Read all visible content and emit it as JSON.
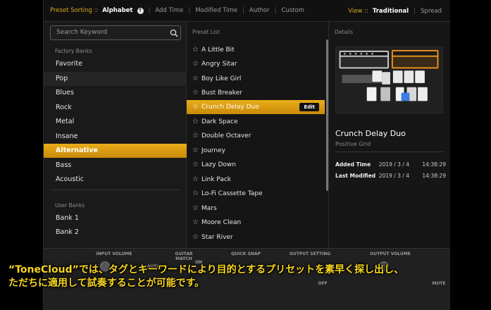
{
  "topbar": {
    "sort_label": "Preset Sorting ::",
    "sort_options": [
      "Alphabet",
      "Add Time",
      "Modified Time",
      "Author",
      "Custom"
    ],
    "view_label": "View ::",
    "view_options": [
      "Traditional",
      "Spread"
    ]
  },
  "search": {
    "placeholder": "Search Keyword"
  },
  "banks": {
    "factory_header": "Factory Banks",
    "factory": [
      "Favorite",
      "Pop",
      "Blues",
      "Rock",
      "Metal",
      "Insane",
      "Alternative",
      "Bass",
      "Acoustic"
    ],
    "user_header": "User Banks",
    "user": [
      "Bank 1",
      "Bank 2"
    ]
  },
  "presets": {
    "header": "Preset List",
    "items": [
      "A Little Bit",
      "Angry Sitar",
      "Boy Like Girl",
      "Bust Breaker",
      "Crunch Delay Duo",
      "Dark Space",
      "Double Octaver",
      "Journey",
      "Lazy Down",
      "Link Pack",
      "Lo-Fi Cassette Tape",
      "Mars",
      "Moore Clean",
      "Star River"
    ],
    "edit_label": "Edit"
  },
  "details": {
    "header": "Details",
    "name": "Crunch Delay Duo",
    "author": "Positive Grid",
    "added_label": "Added Time",
    "added_date": "2019 / 3 / 4",
    "added_time": "14:38:29",
    "modified_label": "Last Modified",
    "modified_date": "2019 / 3 / 4",
    "modified_time": "14:38:29"
  },
  "bottom": {
    "input_volume": "INPUT VOLUME",
    "guitar_match": "GUITAR MATCH",
    "quick_snap": "QUICK SNAP",
    "output_setting": "OUTPUT SETTING",
    "output_volume": "OUTPUT VOLUME",
    "on": "ON",
    "off": "OFF",
    "mute": "MUTE",
    "auto": "AUTO"
  },
  "caption": {
    "line1": "“ToneCloud”では、タグとキーワードにより目的とするプリセットを素早く探し出し、",
    "line2": "ただちに適用して試奏することが可能です。"
  },
  "colors": {
    "accent": "#e9ad1a",
    "label_accent": "#d9a820"
  }
}
